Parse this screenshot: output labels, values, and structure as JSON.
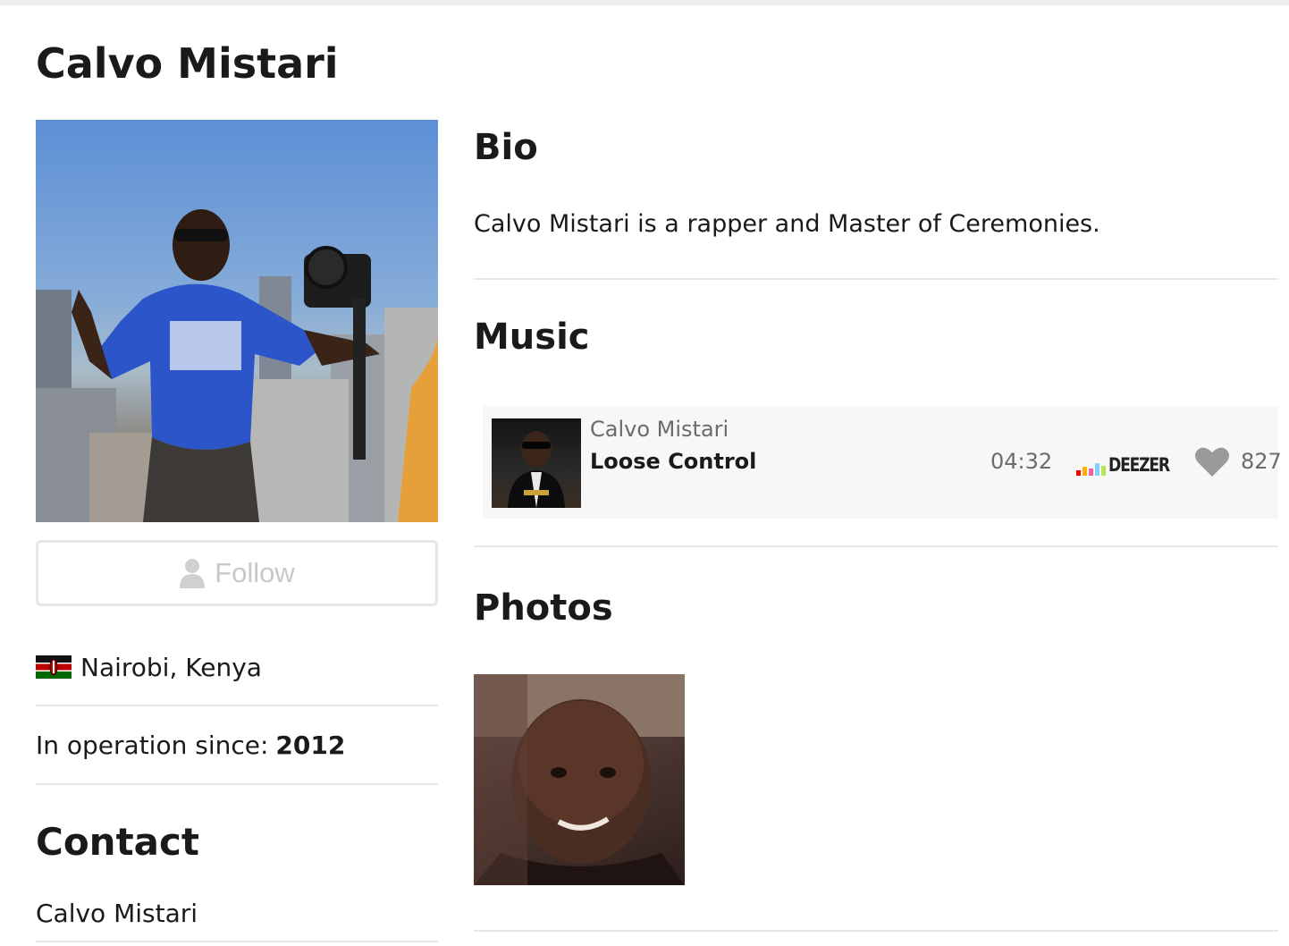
{
  "page": {
    "title": "Calvo Mistari"
  },
  "profile": {
    "follow_label": "Follow",
    "location": "Nairobi, Kenya",
    "since_label": "In operation since:",
    "since_value": "2012",
    "contact_heading": "Contact",
    "contact_name": "Calvo Mistari"
  },
  "bio": {
    "heading": "Bio",
    "text": "Calvo Mistari is a rapper and Master of Ceremonies."
  },
  "music": {
    "heading": "Music",
    "tracks": [
      {
        "artist": "Calvo Mistari",
        "title": "Loose Control",
        "duration": "04:32",
        "provider": "DEEZER",
        "likes": "827"
      }
    ]
  },
  "photos": {
    "heading": "Photos"
  },
  "colors": {
    "border": "#e6e6e6",
    "track_bg": "#f7f7f7",
    "muted_text": "#6b6b6b",
    "heart": "#9a9a9a"
  },
  "icons": {
    "follow": "user-icon",
    "location": "kenya-flag-icon",
    "like": "heart-icon",
    "provider": "deezer-logo"
  }
}
